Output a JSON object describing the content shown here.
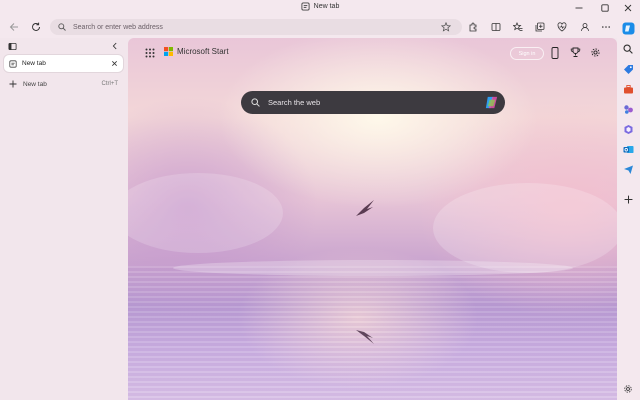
{
  "titlebar": {
    "title": "New tab"
  },
  "toolbar": {
    "address_placeholder": "Search or enter web address"
  },
  "tabs": {
    "active": {
      "label": "New tab"
    },
    "new_tab": {
      "label": "New tab",
      "shortcut": "Ctrl+T"
    }
  },
  "newtab_page": {
    "brand": "Microsoft Start",
    "signin_label": "Sign in",
    "search_placeholder": "Search the web"
  },
  "colors": {
    "accent": "#0f6cbd",
    "search_bg": "#3d3a40"
  }
}
